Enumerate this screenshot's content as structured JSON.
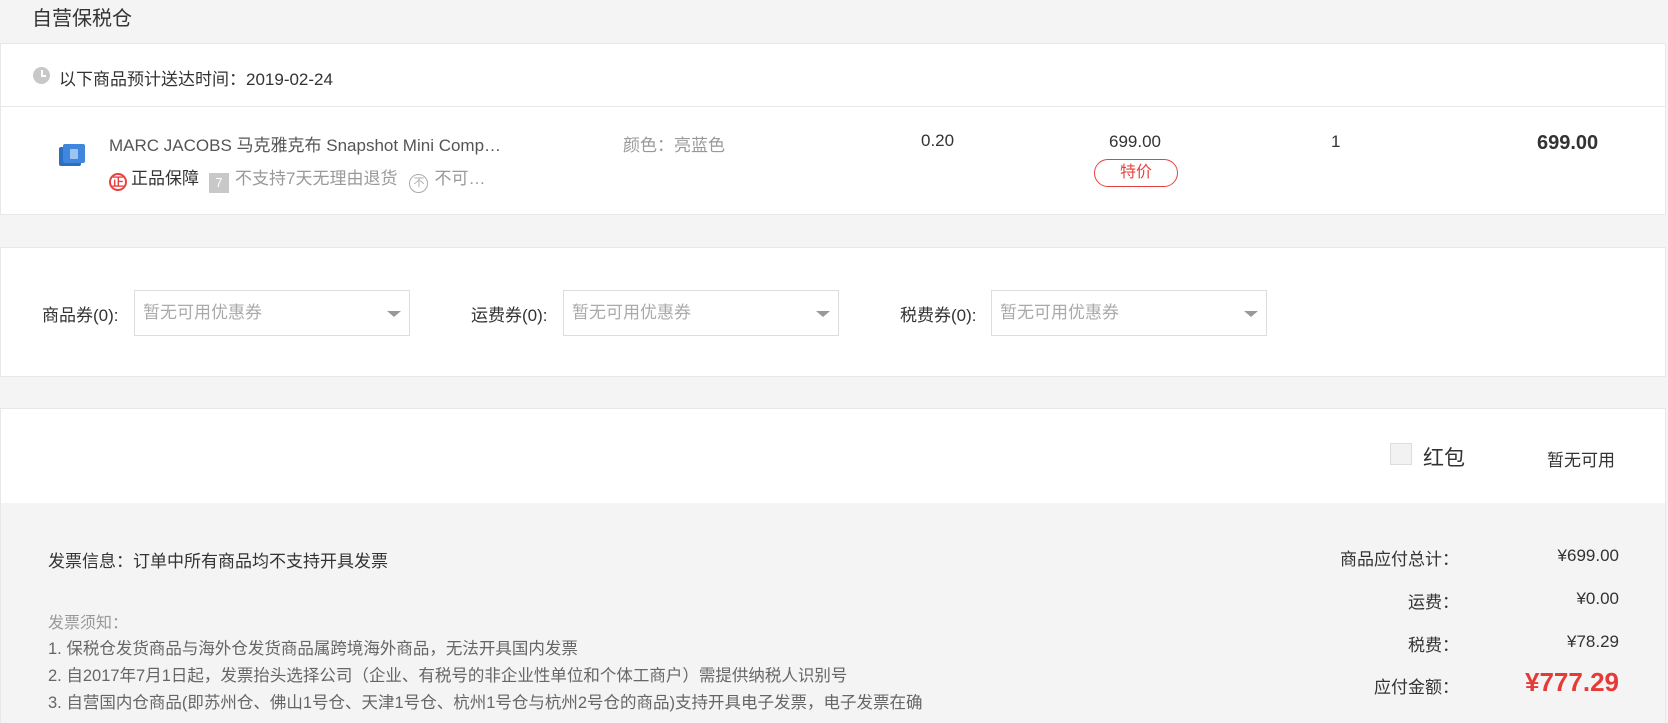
{
  "section": {
    "title": "自营保税仓"
  },
  "delivery": {
    "text": "以下商品预计送达时间：2019-02-24"
  },
  "product": {
    "name": "MARC JACOBS 马克雅克布 Snapshot Mini Comp…",
    "color": "颜色：亮蓝色",
    "weight": "0.20",
    "price": "699.00",
    "special_badge": "特价",
    "quantity": "1",
    "subtotal": "699.00",
    "tags": {
      "authentic_icon": "正",
      "authentic": "正品保障",
      "no_return_icon": "7",
      "no_return": "不支持7天无理由退货",
      "other_icon": "不",
      "other": "不可…"
    }
  },
  "coupons": [
    {
      "label": "商品券(0):",
      "value": "暂无可用优惠券"
    },
    {
      "label": "运费券(0):",
      "value": "暂无可用优惠券"
    },
    {
      "label": "税费券(0):",
      "value": "暂无可用优惠券"
    }
  ],
  "hongbao": {
    "label": "红包",
    "status": "暂无可用"
  },
  "invoice": {
    "info": "发票信息：订单中所有商品均不支持开具发票",
    "notice_title": "发票须知：",
    "notices": [
      "1. 保税仓发货商品与海外仓发货商品属跨境海外商品，无法开具国内发票",
      "2. 自2017年7月1日起，发票抬头选择公司（企业、有税号的非企业性单位和个体工商户）需提供纳税人识别号",
      "3. 自营国内仓商品(即苏州仓、佛山1号仓、天津1号仓、杭州1号仓与杭州2号仓的商品)支持开具电子发票，电子发票在确"
    ]
  },
  "summary": {
    "goods_label": "商品应付总计：",
    "goods_value": "¥699.00",
    "shipping_label": "运费：",
    "shipping_value": "¥0.00",
    "tax_label": "税费：",
    "tax_value": "¥78.29",
    "total_label": "应付金额：",
    "total_value": "¥777.29"
  },
  "colors": {
    "accent": "#e63a37",
    "border": "#e8e8e8",
    "muted": "#999999"
  },
  "icons": {
    "clock": "clock-icon",
    "product_thumb": "product-thumbnail",
    "caret": "chevron-down-icon"
  }
}
